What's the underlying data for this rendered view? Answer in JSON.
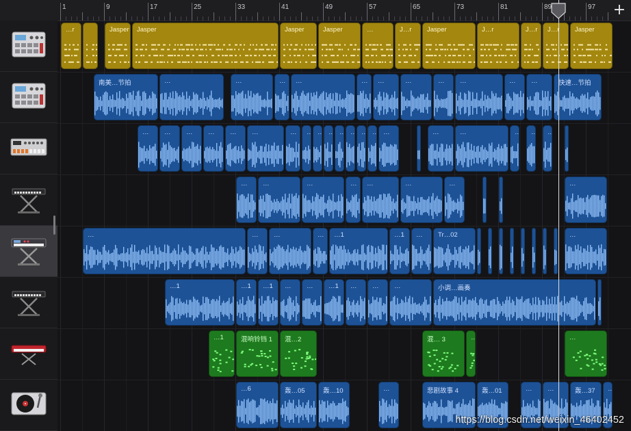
{
  "ruler": {
    "bar_numbers": [
      "1",
      "9",
      "17",
      "25",
      "33",
      "41",
      "49",
      "57",
      "65",
      "73",
      "81",
      "89",
      "97"
    ]
  },
  "add_button": {
    "label": "+"
  },
  "watermark": "https://blog.csdn.net/weixin_46402452",
  "tracks": [
    {
      "name": "drum-machine",
      "icon": "drum-machine-icon",
      "regions": [
        {
          "label": "…r",
          "type": "midi",
          "bar": 1,
          "len": 4
        },
        {
          "label": "",
          "type": "midi",
          "bar": 5,
          "len": 3
        },
        {
          "label": "Jasper",
          "type": "midi",
          "bar": 9,
          "len": 5
        },
        {
          "label": "Jasper",
          "type": "midi",
          "bar": 14,
          "len": 27
        },
        {
          "label": "Jasper",
          "type": "midi",
          "bar": 41,
          "len": 7
        },
        {
          "label": "Jasper",
          "type": "midi",
          "bar": 48,
          "len": 8
        },
        {
          "label": "…",
          "type": "midi",
          "bar": 56,
          "len": 6
        },
        {
          "label": "J…r",
          "type": "midi",
          "bar": 62,
          "len": 5
        },
        {
          "label": "Jasper",
          "type": "midi",
          "bar": 67,
          "len": 10
        },
        {
          "label": "J…r",
          "type": "midi",
          "bar": 77,
          "len": 8
        },
        {
          "label": "J…r",
          "type": "midi",
          "bar": 85,
          "len": 4
        },
        {
          "label": "J…r",
          "type": "midi",
          "bar": 89,
          "len": 5
        },
        {
          "label": "Jasper",
          "type": "midi",
          "bar": 94,
          "len": 8
        }
      ]
    },
    {
      "name": "drum-machine-2",
      "icon": "drum-machine-icon",
      "regions": [
        {
          "label": "南美…节拍",
          "type": "audio",
          "bar": 7,
          "len": 12
        },
        {
          "label": "…",
          "type": "audio",
          "bar": 19,
          "len": 12
        },
        {
          "label": "…",
          "type": "audio",
          "bar": 32,
          "len": 8
        },
        {
          "label": "…",
          "type": "audio",
          "bar": 40,
          "len": 3
        },
        {
          "label": "…",
          "type": "audio",
          "bar": 43,
          "len": 12
        },
        {
          "label": "…",
          "type": "audio",
          "bar": 55,
          "len": 3
        },
        {
          "label": "…",
          "type": "audio",
          "bar": 58,
          "len": 5
        },
        {
          "label": "…",
          "type": "audio",
          "bar": 63,
          "len": 6
        },
        {
          "label": "…",
          "type": "audio",
          "bar": 69,
          "len": 4
        },
        {
          "label": "…",
          "type": "audio",
          "bar": 73,
          "len": 9
        },
        {
          "label": "…",
          "type": "audio",
          "bar": 82,
          "len": 4
        },
        {
          "label": "…",
          "type": "audio",
          "bar": 86,
          "len": 5
        },
        {
          "label": "快速…节拍",
          "type": "audio",
          "bar": 91,
          "len": 9
        }
      ]
    },
    {
      "name": "groovebox",
      "icon": "groovebox-icon",
      "regions": [
        {
          "label": "…",
          "type": "audio",
          "bar": 15,
          "len": 4
        },
        {
          "label": "…",
          "type": "audio",
          "bar": 19,
          "len": 4
        },
        {
          "label": "…",
          "type": "audio",
          "bar": 23,
          "len": 4
        },
        {
          "label": "…",
          "type": "audio",
          "bar": 27,
          "len": 4
        },
        {
          "label": "…",
          "type": "audio",
          "bar": 31,
          "len": 4
        },
        {
          "label": "…",
          "type": "audio",
          "bar": 35,
          "len": 7
        },
        {
          "label": "…",
          "type": "audio",
          "bar": 42,
          "len": 3
        },
        {
          "label": "…",
          "type": "audio",
          "bar": 45,
          "len": 2
        },
        {
          "label": "…",
          "type": "audio",
          "bar": 47,
          "len": 2
        },
        {
          "label": "…",
          "type": "audio",
          "bar": 49,
          "len": 2
        },
        {
          "label": "…",
          "type": "audio",
          "bar": 51,
          "len": 2
        },
        {
          "label": "…",
          "type": "audio",
          "bar": 53,
          "len": 2
        },
        {
          "label": "…",
          "type": "audio",
          "bar": 55,
          "len": 2
        },
        {
          "label": "…",
          "type": "audio",
          "bar": 57,
          "len": 2
        },
        {
          "label": "…",
          "type": "audio",
          "bar": 59,
          "len": 4
        },
        {
          "label": "…",
          "type": "audio",
          "bar": 66,
          "len": 1
        },
        {
          "label": "…",
          "type": "audio",
          "bar": 68,
          "len": 5
        },
        {
          "label": "…",
          "type": "audio",
          "bar": 73,
          "len": 10
        },
        {
          "label": "…",
          "type": "audio",
          "bar": 83,
          "len": 2
        },
        {
          "label": "…",
          "type": "audio",
          "bar": 86,
          "len": 2
        },
        {
          "label": "…",
          "type": "audio",
          "bar": 89,
          "len": 2
        },
        {
          "label": "…",
          "type": "audio",
          "bar": 93,
          "len": 1
        }
      ]
    },
    {
      "name": "keyboard-1",
      "icon": "keyboard-stand-icon",
      "regions": [
        {
          "label": "…",
          "type": "audio",
          "bar": 33,
          "len": 4
        },
        {
          "label": "…",
          "type": "audio",
          "bar": 37,
          "len": 8
        },
        {
          "label": "…",
          "type": "audio",
          "bar": 45,
          "len": 8
        },
        {
          "label": "…",
          "type": "audio",
          "bar": 53,
          "len": 3
        },
        {
          "label": "…",
          "type": "audio",
          "bar": 56,
          "len": 7
        },
        {
          "label": "…",
          "type": "audio",
          "bar": 63,
          "len": 8
        },
        {
          "label": "…",
          "type": "audio",
          "bar": 71,
          "len": 4
        },
        {
          "label": "…",
          "type": "audio",
          "bar": 78,
          "len": 1
        },
        {
          "label": "…",
          "type": "audio",
          "bar": 81,
          "len": 1
        },
        {
          "label": "…",
          "type": "audio",
          "bar": 93,
          "len": 8
        }
      ]
    },
    {
      "name": "synth-workstation",
      "icon": "synth-stand-icon",
      "selected": true,
      "regions": [
        {
          "label": "…",
          "type": "audio",
          "bar": 5,
          "len": 30
        },
        {
          "label": "…",
          "type": "audio",
          "bar": 35,
          "len": 4
        },
        {
          "label": "…",
          "type": "audio",
          "bar": 39,
          "len": 8
        },
        {
          "label": "…",
          "type": "audio",
          "bar": 47,
          "len": 3
        },
        {
          "label": "…1",
          "type": "audio",
          "bar": 50,
          "len": 11
        },
        {
          "label": "…1",
          "type": "audio",
          "bar": 61,
          "len": 4
        },
        {
          "label": "…",
          "type": "audio",
          "bar": 65,
          "len": 4
        },
        {
          "label": "Tr…02",
          "type": "audio",
          "bar": 69,
          "len": 8
        },
        {
          "label": "…",
          "type": "audio",
          "bar": 77,
          "len": 1
        },
        {
          "label": "…",
          "type": "audio",
          "bar": 79,
          "len": 1
        },
        {
          "label": "…",
          "type": "audio",
          "bar": 81,
          "len": 1
        },
        {
          "label": "…",
          "type": "audio",
          "bar": 83,
          "len": 1
        },
        {
          "label": "…",
          "type": "audio",
          "bar": 85,
          "len": 1
        },
        {
          "label": "…",
          "type": "audio",
          "bar": 87,
          "len": 1
        },
        {
          "label": "…",
          "type": "audio",
          "bar": 89,
          "len": 1
        },
        {
          "label": "…",
          "type": "audio",
          "bar": 91,
          "len": 1
        },
        {
          "label": "…",
          "type": "audio",
          "bar": 93,
          "len": 8
        }
      ]
    },
    {
      "name": "keyboard-2",
      "icon": "keyboard-stand-icon",
      "regions": [
        {
          "label": "…1",
          "type": "audio",
          "bar": 20,
          "len": 13
        },
        {
          "label": "…1",
          "type": "audio",
          "bar": 33,
          "len": 4
        },
        {
          "label": "…1",
          "type": "audio",
          "bar": 37,
          "len": 4
        },
        {
          "label": "…",
          "type": "audio",
          "bar": 41,
          "len": 4
        },
        {
          "label": "…",
          "type": "audio",
          "bar": 45,
          "len": 4
        },
        {
          "label": "…1",
          "type": "audio",
          "bar": 49,
          "len": 4
        },
        {
          "label": "…",
          "type": "audio",
          "bar": 53,
          "len": 4
        },
        {
          "label": "…",
          "type": "audio",
          "bar": 57,
          "len": 4
        },
        {
          "label": "…",
          "type": "audio",
          "bar": 61,
          "len": 8
        },
        {
          "label": "小调…画奏",
          "type": "audio",
          "bar": 69,
          "len": 30
        },
        {
          "label": "…",
          "type": "audio",
          "bar": 99,
          "len": 1
        }
      ]
    },
    {
      "name": "red-keyboard",
      "icon": "red-keyboard-icon",
      "regions": [
        {
          "label": "…1",
          "type": "green",
          "bar": 28,
          "len": 5
        },
        {
          "label": "混响铃铛 1",
          "type": "green",
          "bar": 33,
          "len": 8
        },
        {
          "label": "混…2",
          "type": "green",
          "bar": 41,
          "len": 7
        },
        {
          "label": "混… 3",
          "type": "green",
          "bar": 67,
          "len": 8
        },
        {
          "label": "…",
          "type": "green",
          "bar": 75,
          "len": 2
        },
        {
          "label": "…",
          "type": "green",
          "bar": 93,
          "len": 8
        }
      ]
    },
    {
      "name": "turntable",
      "icon": "turntable-icon",
      "regions": [
        {
          "label": "…6",
          "type": "audio",
          "bar": 33,
          "len": 8
        },
        {
          "label": "轰…05",
          "type": "audio",
          "bar": 41,
          "len": 7
        },
        {
          "label": "轰…10",
          "type": "audio",
          "bar": 48,
          "len": 6
        },
        {
          "label": "…",
          "type": "audio",
          "bar": 59,
          "len": 4
        },
        {
          "label": "悲剧故事 4",
          "type": "audio",
          "bar": 67,
          "len": 10
        },
        {
          "label": "轰…01",
          "type": "audio",
          "bar": 77,
          "len": 6
        },
        {
          "label": "…",
          "type": "audio",
          "bar": 85,
          "len": 4
        },
        {
          "label": "…",
          "type": "audio",
          "bar": 89,
          "len": 5
        },
        {
          "label": "轰…37",
          "type": "audio",
          "bar": 94,
          "len": 6
        },
        {
          "label": "…",
          "type": "audio",
          "bar": 100,
          "len": 2
        }
      ]
    }
  ]
}
